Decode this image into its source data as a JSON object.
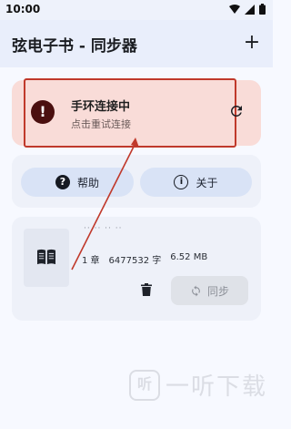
{
  "statusbar": {
    "time": "10:00"
  },
  "appbar": {
    "title": "弦电子书 - 同步器",
    "add_label": "+"
  },
  "error_card": {
    "title": "手环连接中",
    "subtitle": "点击重试连接",
    "icon": "alert-icon",
    "highlight_color": "#c0392b"
  },
  "actions": {
    "help_label": "帮助",
    "about_label": "关于"
  },
  "book": {
    "title_obscured": "·· ·· ·· ··",
    "chapters": "1 章",
    "word_count": "6477532 字",
    "size": "6.52 MB",
    "sync_label": "同步"
  },
  "watermark": {
    "badge": "听",
    "text": "一听下载"
  },
  "colors": {
    "error_card_bg": "#f9dcd8",
    "error_icon_bg": "#4b0f0f",
    "annotation_red": "#c0392b",
    "pill_bg": "#d9e3f6"
  }
}
